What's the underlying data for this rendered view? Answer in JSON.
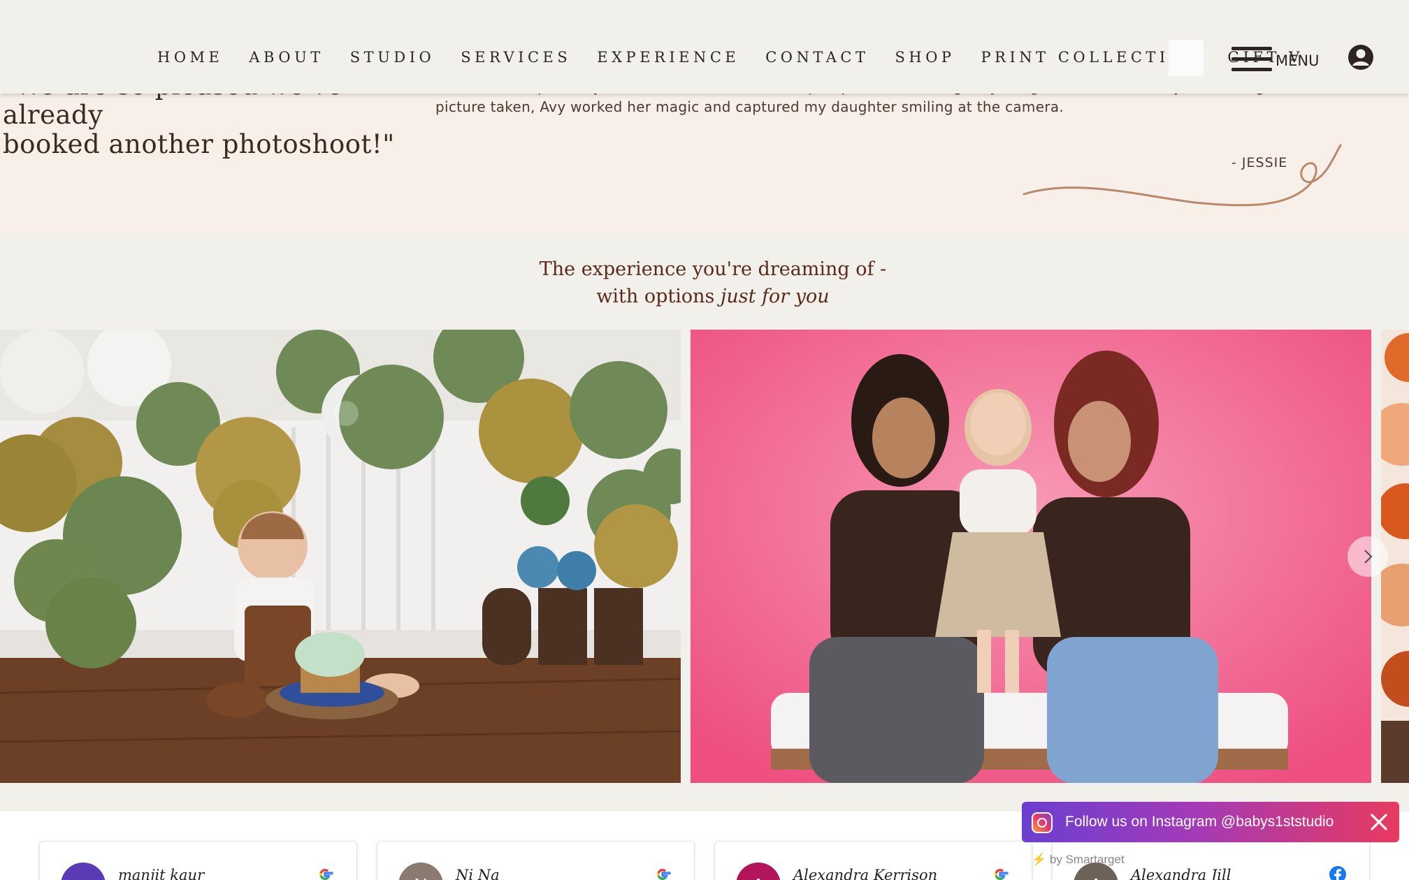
{
  "nav": {
    "links": [
      "HOME",
      "ABOUT",
      "STUDIO",
      "SERVICES",
      "EXPERIENCE",
      "CONTACT",
      "SHOP",
      "PRINT COLLECTION",
      "GIFT V"
    ],
    "menu_label": "MENU",
    "account_icon": "account-icon"
  },
  "testimonial": {
    "quote_line1": "\"We are so pleased we've already",
    "quote_line2": "booked another photoshoot!\"",
    "text_line1": "in future. She perfectly accommodated our backdrop request even though my daughter doesn't usually like having her",
    "text_line2": "picture taken, Avy worked her magic and captured my daughter smiling at the camera.",
    "author": "- JESSIE"
  },
  "experience": {
    "heading_line1": "The experience you're dreaming of -",
    "heading_line2_plain": "with options ",
    "heading_line2_italic": "just for you"
  },
  "gallery": {
    "next_icon": "chevron-right-icon"
  },
  "reviews": [
    {
      "name": "manjit kaur",
      "initial": "m",
      "avatar_color": "#5b3bb5",
      "source": "google"
    },
    {
      "name": "Ni Na",
      "initial": "N",
      "avatar_color": "#8a7a70",
      "source": "google"
    },
    {
      "name": "Alexandra Kerrison",
      "initial": "A",
      "avatar_color": "#b3155a",
      "source": "google"
    },
    {
      "name": "Alexandra Jill",
      "initial": "A",
      "avatar_color": "#6e6258",
      "source": "facebook"
    }
  ],
  "instagram": {
    "text": "Follow us on Instagram @babys1ststudio",
    "powered_prefix": "by Smartarget",
    "close_icon": "close-icon"
  },
  "colors": {
    "nav_bg": "#f2f0eb",
    "testimonial_bg": "#f8efe9",
    "heading": "#5a2a1a",
    "swirl": "#b88a6c"
  }
}
